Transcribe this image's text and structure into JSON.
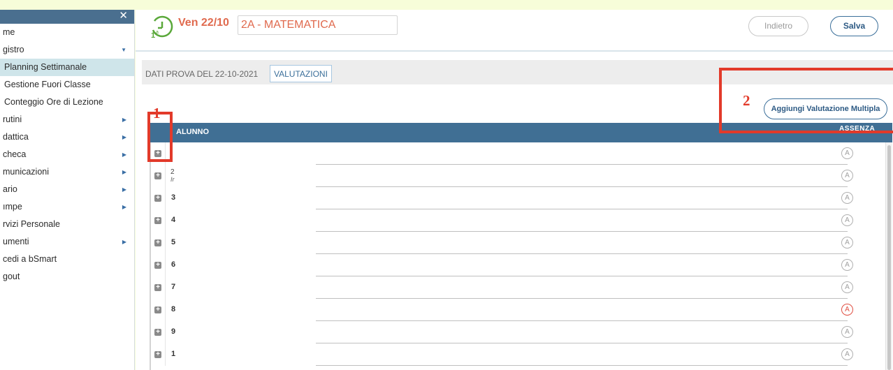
{
  "sidebar": {
    "items": [
      {
        "label": "me",
        "arrow": "",
        "active": false
      },
      {
        "label": "gistro",
        "arrow": "down",
        "active": false
      },
      {
        "label": "Planning Settimanale",
        "arrow": "",
        "active": true
      },
      {
        "label": "Gestione Fuori Classe",
        "arrow": "",
        "active": false
      },
      {
        "label": "Conteggio Ore di Lezione",
        "arrow": "",
        "active": false
      },
      {
        "label": "rutini",
        "arrow": "right",
        "active": false
      },
      {
        "label": "dattica",
        "arrow": "right",
        "active": false
      },
      {
        "label": "checa",
        "arrow": "right",
        "active": false
      },
      {
        "label": "municazioni",
        "arrow": "right",
        "active": false
      },
      {
        "label": "ario",
        "arrow": "right",
        "active": false
      },
      {
        "label": "ımpe",
        "arrow": "right",
        "active": false
      },
      {
        "label": "rvizi Personale",
        "arrow": "",
        "active": false
      },
      {
        "label": "umenti",
        "arrow": "right",
        "active": false
      },
      {
        "label": "cedi a bSmart",
        "arrow": "",
        "active": false
      },
      {
        "label": "gout",
        "arrow": "",
        "active": false
      }
    ]
  },
  "header": {
    "date": "Ven 22/10",
    "class": "2A - MATEMATICA",
    "back_label": "Indietro",
    "save_label": "Salva"
  },
  "tabs": {
    "dati": "DATI PROVA DEL 22-10-2021",
    "valutazioni": "VALUTAZIONI"
  },
  "multi_button": "Aggiungi Valutazione Multipla",
  "annotations": {
    "one": "1",
    "two": "2"
  },
  "table": {
    "col_alunno": "ALUNNO",
    "col_assenza": "ASSENZA",
    "rows": [
      {
        "num": "",
        "sub": "",
        "absent": false
      },
      {
        "num": "2",
        "sub": "Ir",
        "absent": false
      },
      {
        "num": "3",
        "sub": "",
        "absent": false
      },
      {
        "num": "4",
        "sub": "",
        "absent": false
      },
      {
        "num": "5",
        "sub": "",
        "absent": false
      },
      {
        "num": "6",
        "sub": "",
        "absent": false
      },
      {
        "num": "7",
        "sub": "",
        "absent": false
      },
      {
        "num": "8",
        "sub": "",
        "absent": true
      },
      {
        "num": "9",
        "sub": "",
        "absent": false
      },
      {
        "num": "1",
        "sub": "",
        "absent": false
      }
    ],
    "absence_letter": "A"
  },
  "colors": {
    "accent": "#e06a4e",
    "header_blue": "#406f94",
    "annotation_red": "#e23a2a",
    "active_menu": "#cfe5ea"
  }
}
